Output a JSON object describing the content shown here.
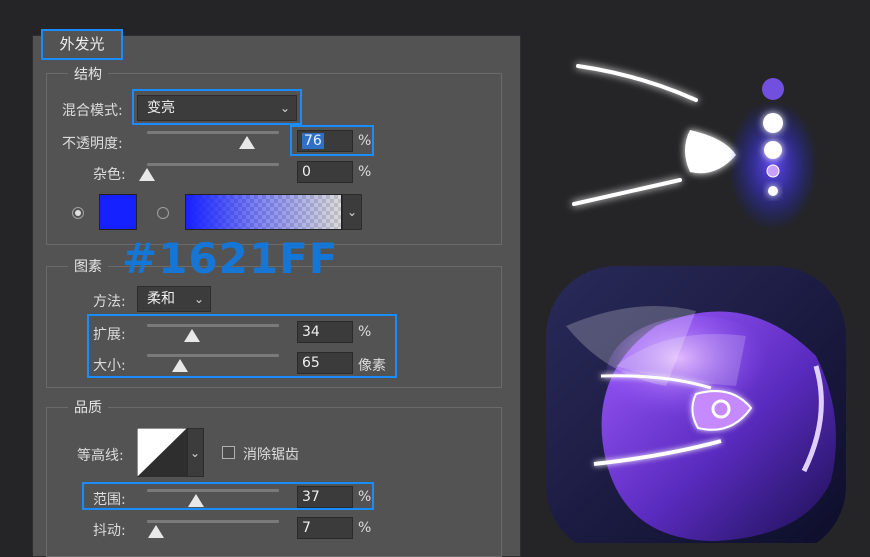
{
  "dialog": {
    "title": "外发光",
    "structure": {
      "label": "结构",
      "blend_mode_label": "混合模式:",
      "blend_mode_value": "变亮",
      "opacity_label": "不透明度:",
      "opacity_value": "76",
      "opacity_percent": 0.76,
      "opacity_unit": "%",
      "noise_label": "杂色:",
      "noise_value": "0",
      "noise_percent": 0,
      "noise_unit": "%",
      "color": "#1621FF"
    },
    "elements": {
      "label": "图素",
      "technique_label": "方法:",
      "technique_value": "柔和",
      "spread_label": "扩展:",
      "spread_value": "34",
      "spread_percent": 0.34,
      "spread_unit": "%",
      "size_label": "大小:",
      "size_value": "65",
      "size_fraction": 0.25,
      "size_unit": "像素"
    },
    "quality": {
      "label": "品质",
      "contour_label": "等高线:",
      "antialias_label": "消除锯齿",
      "range_label": "范围:",
      "range_value": "37",
      "range_percent": 0.37,
      "range_unit": "%",
      "jitter_label": "抖动:",
      "jitter_value": "7",
      "jitter_percent": 0.07,
      "jitter_unit": "%"
    }
  },
  "annotation": {
    "hex_color_text": "#1621FF"
  },
  "colors": {
    "highlight": "#1b8cff",
    "glow": "#1621FF"
  }
}
